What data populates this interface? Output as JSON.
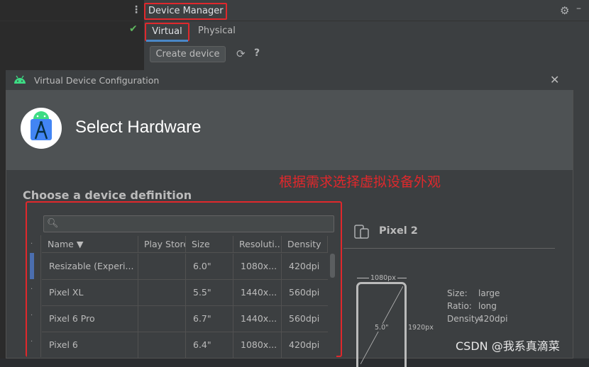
{
  "device_manager": {
    "title": "Device Manager",
    "tabs": [
      {
        "label": "Virtual",
        "selected": true
      },
      {
        "label": "Physical",
        "selected": false
      }
    ],
    "create_device_label": "Create device",
    "help_label": "?"
  },
  "dialog": {
    "window_title": "Virtual Device Configuration",
    "header_title": "Select Hardware",
    "annotation": "根据需求选择虚拟设备外观",
    "section_label": "Choose a device definition",
    "search": {
      "value": "",
      "placeholder": ""
    },
    "table": {
      "columns": [
        "Name ▼",
        "Play Store",
        "Size",
        "Resoluti...",
        "Density"
      ],
      "rows": [
        {
          "name": "Resizable (Experi...",
          "play_store": "",
          "size": "6.0\"",
          "resolution": "1080x...",
          "density": "420dpi",
          "selected": true
        },
        {
          "name": "Pixel XL",
          "play_store": "",
          "size": "5.5\"",
          "resolution": "1440x...",
          "density": "560dpi",
          "selected": false
        },
        {
          "name": "Pixel 6 Pro",
          "play_store": "",
          "size": "6.7\"",
          "resolution": "1440x...",
          "density": "560dpi",
          "selected": false
        },
        {
          "name": "Pixel 6",
          "play_store": "",
          "size": "6.4\"",
          "resolution": "1080x...",
          "density": "420dpi",
          "selected": false
        }
      ]
    },
    "preview": {
      "device_name": "Pixel 2",
      "width_label": "1080px",
      "height_label": "1920px",
      "diagonal_label": "5.0\"",
      "specs": [
        {
          "label": "Size:",
          "value": "large"
        },
        {
          "label": "Ratio:",
          "value": "long"
        },
        {
          "label": "Density:",
          "value": "420dpi"
        }
      ]
    }
  },
  "watermark": "CSDN @我系真滴菜",
  "colors": {
    "highlight_box": "#e0282c",
    "accent": "#4a88c7",
    "selection": "#4b6eaf"
  }
}
